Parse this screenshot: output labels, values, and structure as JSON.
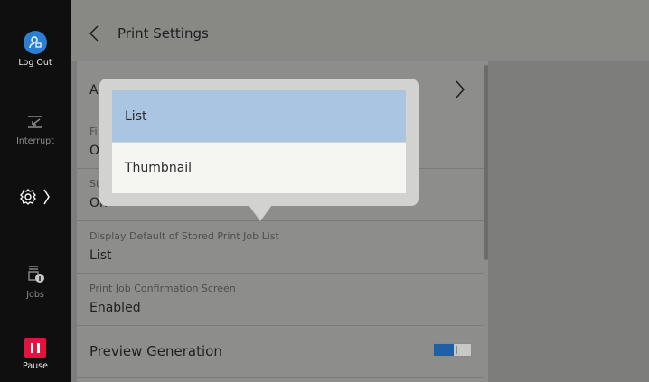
{
  "sidebar": {
    "logout_label": "Log Out",
    "interrupt_label": "Interrupt",
    "jobs_label": "Jobs",
    "pause_label": "Pause"
  },
  "header": {
    "title": "Print Settings"
  },
  "rows": [
    {
      "title": "A"
    },
    {
      "label": "Fi",
      "value": "O"
    },
    {
      "label": "St",
      "value": "On"
    },
    {
      "label": "Display Default of Stored Print Job List",
      "value": "List"
    },
    {
      "label": "Print Job Confirmation Screen",
      "value": "Enabled"
    },
    {
      "title": "Preview Generation"
    }
  ],
  "popup": {
    "options": [
      "List",
      "Thumbnail"
    ],
    "selected": "List"
  },
  "colors": {
    "selected_option": "#aac5e2",
    "accent": "#2a7fd2",
    "pause": "#e4123e"
  }
}
